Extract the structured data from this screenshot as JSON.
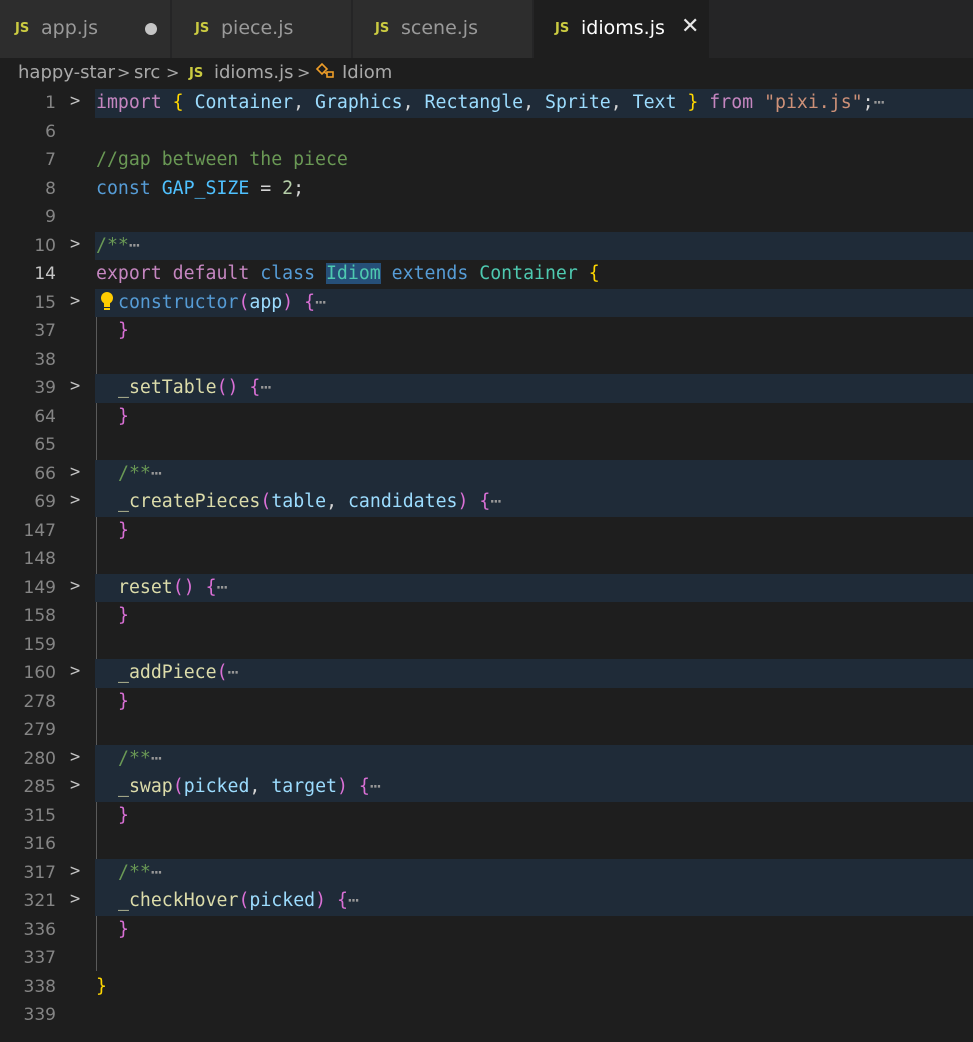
{
  "tabs": [
    {
      "icon": "JS",
      "label": "app.js",
      "modified": true,
      "active": false
    },
    {
      "icon": "JS",
      "label": "piece.js",
      "modified": false,
      "active": false
    },
    {
      "icon": "JS",
      "label": "scene.js",
      "modified": false,
      "active": false
    },
    {
      "icon": "JS",
      "label": "idioms.js",
      "modified": false,
      "active": true,
      "close": "✕"
    }
  ],
  "breadcrumb": {
    "root": "happy-star",
    "folder": "src",
    "file_icon": "JS",
    "file": "idioms.js",
    "symbol_icon": "class-symbol-icon",
    "symbol": "Idiom"
  },
  "editor": {
    "line_numbers": [
      "1",
      "6",
      "7",
      "8",
      "9",
      "10",
      "14",
      "15",
      "37",
      "38",
      "39",
      "64",
      "65",
      "66",
      "69",
      "147",
      "148",
      "149",
      "158",
      "159",
      "160",
      "278",
      "279",
      "280",
      "285",
      "315",
      "316",
      "317",
      "321",
      "336",
      "337",
      "338",
      "339"
    ],
    "ellipsis": "⋯",
    "line1": {
      "kw_import": "import",
      "b_open": "{",
      "names": [
        "Container",
        "Graphics",
        "Rectangle",
        "Sprite",
        "Text"
      ],
      "b_close": "}",
      "kw_from": "from",
      "module": "\"pixi.js\"",
      "end": ";"
    },
    "line7_comment": "//gap between the piece",
    "line8": {
      "kw": "const",
      "name": "GAP_SIZE",
      "op": "=",
      "value": "2",
      "end": ";"
    },
    "doc_comment": "/**",
    "line14": {
      "kw_export": "export",
      "kw_default": "default",
      "kw_class": "class",
      "name": "Idiom",
      "kw_extends": "extends",
      "parent": "Container",
      "brace": "{"
    },
    "methods": {
      "constructor": {
        "name": "constructor",
        "params": "app"
      },
      "setTable": {
        "name": "_setTable",
        "params": ""
      },
      "createPieces": {
        "name": "_createPieces",
        "params": [
          "table",
          "candidates"
        ]
      },
      "reset": {
        "name": "reset",
        "params": ""
      },
      "addPiece": {
        "name": "_addPiece"
      },
      "swap": {
        "name": "_swap",
        "params": [
          "picked",
          "target"
        ]
      },
      "checkHover": {
        "name": "_checkHover",
        "params": "picked"
      }
    },
    "close_brace": "}"
  }
}
